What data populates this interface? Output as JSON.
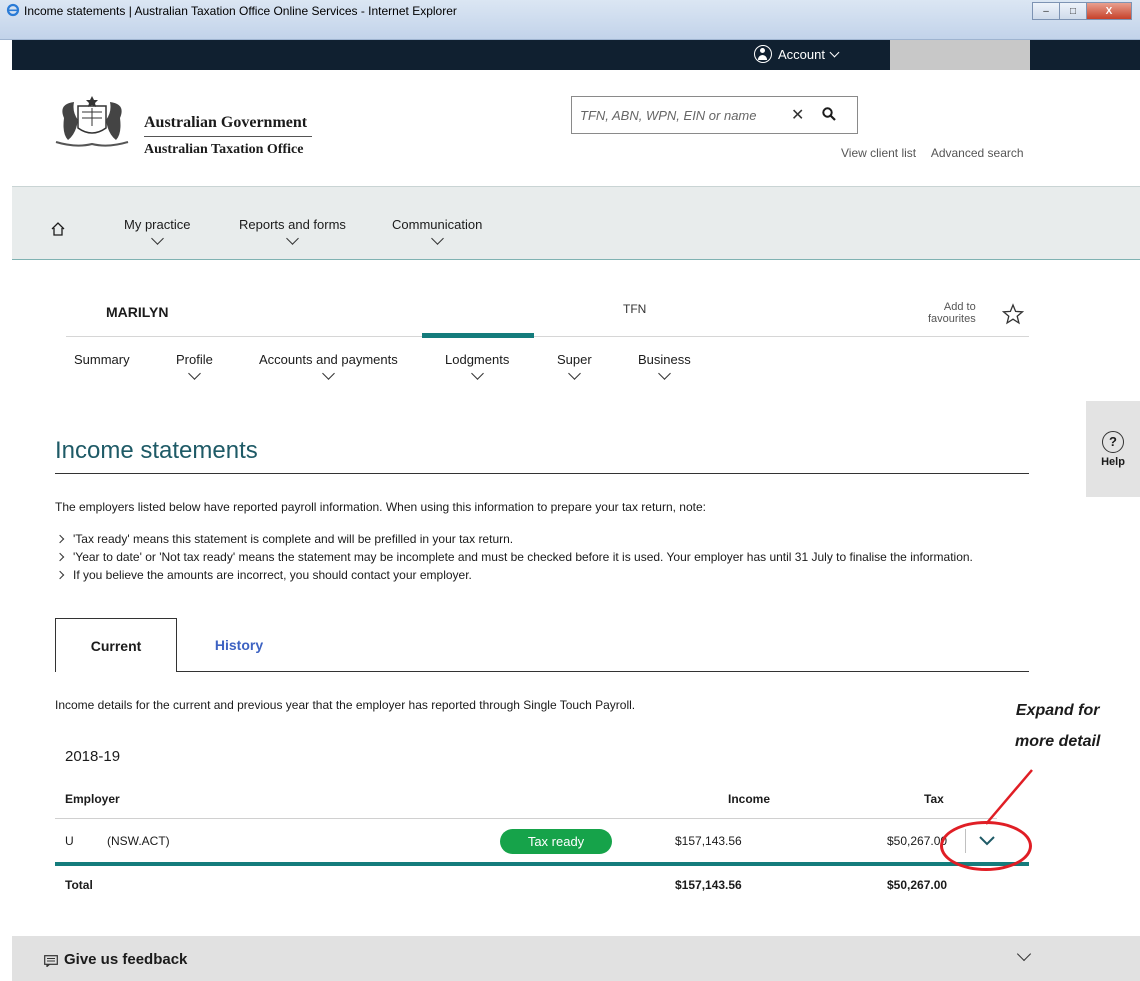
{
  "window": {
    "title": "Income statements | Australian Taxation Office Online Services - Internet Explorer",
    "min_label": "–",
    "max_label": "□",
    "close_label": "X"
  },
  "topbar": {
    "account_label": "Account"
  },
  "header": {
    "gov_line1": "Australian Government",
    "gov_line2": "Australian Taxation Office",
    "search_placeholder": "TFN, ABN, WPN, EIN or name",
    "links": [
      "View client list",
      "Advanced search"
    ]
  },
  "mainnav": {
    "items": [
      {
        "label": "My practice"
      },
      {
        "label": "Reports and forms"
      },
      {
        "label": "Communication"
      }
    ]
  },
  "client": {
    "name": "MARILYN",
    "tfn_label": "TFN",
    "fav_line1": "Add to",
    "fav_line2": "favourites"
  },
  "subnav": {
    "items": [
      {
        "label": "Summary"
      },
      {
        "label": "Profile"
      },
      {
        "label": "Accounts and payments"
      },
      {
        "label": "Lodgments"
      },
      {
        "label": "Super"
      },
      {
        "label": "Business"
      }
    ]
  },
  "help": {
    "label": "Help",
    "icon_char": "?"
  },
  "page": {
    "title": "Income statements",
    "intro": "The employers listed below have reported payroll information. When using this information to prepare your tax return, note:",
    "bullets": [
      "'Tax ready' means this statement is complete and will be prefilled in your tax return.",
      "'Year to date' or 'Not tax ready' means the statement may be incomplete and must be checked before it is used. Your employer has until 31 July to finalise the information.",
      "If you believe the amounts are incorrect, you should contact your employer."
    ]
  },
  "tabs": {
    "current": "Current",
    "history": "History"
  },
  "tab_description": "Income details for the current and previous year that the employer has reported through Single Touch Payroll.",
  "annotation": {
    "line1": "Expand for",
    "line2": "more detail",
    "color": "#e01e25"
  },
  "statement": {
    "year": "2018-19",
    "columns": {
      "employer": "Employer",
      "income": "Income",
      "tax": "Tax"
    },
    "rows": [
      {
        "initial": "U",
        "employer": "(NSW.ACT)",
        "status": "Tax ready",
        "income": "$157,143.56",
        "tax": "$50,267.00"
      }
    ],
    "total_label": "Total",
    "total_income": "$157,143.56",
    "total_tax": "$50,267.00"
  },
  "feedback": {
    "label": "Give us feedback"
  },
  "colors": {
    "teal": "#147c7c",
    "navy": "#102030",
    "badge_green": "#16a34a",
    "history_link": "#3d62c2"
  }
}
